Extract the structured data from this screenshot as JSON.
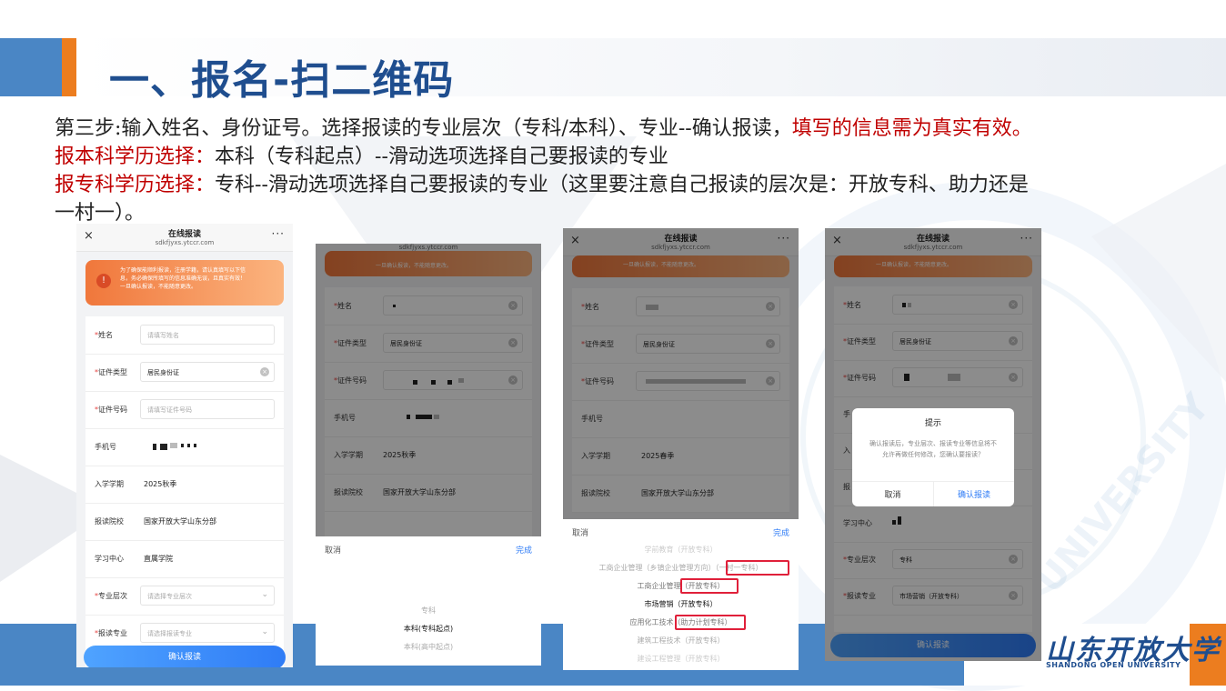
{
  "slide": {
    "title": "一、报名-扫二维码",
    "line1_black": "第三步:输入姓名、身份证号。选择报读的专业层次（专科/本科）、专业--确认报读，",
    "line1_red": "填写的信息需为真实有效。",
    "line2_red": "报本科学历选择：",
    "line2_black": "本科（专科起点）--滑动选项选择自己要报读的专业",
    "line3_red": "报专科学历选择：",
    "line3_black": "专科--滑动选项选择自己要报读的专业（这里要注意自己报读的层次是：开放专科、助力还是",
    "line4_black": "一村一）。",
    "logo_text": "山东开放大学",
    "logo_sub": "SHANDONG OPEN UNIVERSITY",
    "watermark_text": "UNIVERSITY"
  },
  "colors": {
    "title_blue": "#1f4e8f",
    "accent_orange": "#ec7d1f",
    "band_blue": "#4a86c5",
    "highlight_red": "#c00000",
    "primary_button": "#2f7cf6"
  },
  "phone_common": {
    "header_title": "在线报读",
    "header_url": "sdkfjyxs.ytccr.com",
    "close_icon": "×",
    "more_icon": "···"
  },
  "phone1": {
    "banner_lines": [
      "为了确保能顺利报读，注册学籍，请认真填写以下信",
      "息，务必确保所填写的信息准确无误，且真实有效！",
      "一旦确认报读，不能随意更改。"
    ],
    "banner_icon": "!",
    "fields": [
      {
        "label": "姓名",
        "required": true,
        "placeholder": "请填写姓名"
      },
      {
        "label": "证件类型",
        "required": true,
        "value": "居民身份证"
      },
      {
        "label": "证件号码",
        "required": true,
        "placeholder": "请填写证件号码"
      },
      {
        "label": "手机号",
        "required": false
      },
      {
        "label": "入学学期",
        "required": false,
        "value": "2025秋季"
      },
      {
        "label": "报读院校",
        "required": false,
        "value": "国家开放大学山东分部"
      },
      {
        "label": "学习中心",
        "required": false,
        "value": "直属学院"
      },
      {
        "label": "专业层次",
        "required": true,
        "placeholder": "请选择专业层次"
      },
      {
        "label": "报读专业",
        "required": true,
        "placeholder": "请选择报读专业"
      }
    ],
    "submit": "确认报读"
  },
  "phone2": {
    "url_partial": "sdkfjyxs.ytccr.com",
    "banner_partial": "一旦确认报读，不能随意更改。",
    "fields": [
      {
        "label": "姓名",
        "required": true
      },
      {
        "label": "证件类型",
        "required": true,
        "value": "居民身份证"
      },
      {
        "label": "证件号码",
        "required": true
      },
      {
        "label": "手机号",
        "required": false
      },
      {
        "label": "入学学期",
        "required": false,
        "value": "2025秋季"
      },
      {
        "label": "报读院校",
        "required": false,
        "value": "国家开放大学山东分部"
      }
    ],
    "sheet_cancel": "取消",
    "sheet_ok": "完成",
    "options": [
      "专科",
      "本科(专科起点)",
      "本科(高中起点)"
    ],
    "selected_index": 1
  },
  "phone3": {
    "banner_partial": "一旦确认报读，不能随意更改。",
    "fields": [
      {
        "label": "姓名",
        "required": true
      },
      {
        "label": "证件类型",
        "required": true,
        "value": "居民身份证"
      },
      {
        "label": "证件号码",
        "required": true
      },
      {
        "label": "手机号",
        "required": false
      },
      {
        "label": "入学学期",
        "required": false,
        "value": "2025春季"
      },
      {
        "label": "报读院校",
        "required": false,
        "value": "国家开放大学山东分部"
      }
    ],
    "sheet_cancel": "取消",
    "sheet_ok": "完成",
    "options": [
      {
        "name": "学前教育",
        "tag": "（开放专科）"
      },
      {
        "name": "工商企业管理（乡镇企业管理方向）",
        "tag": "（一村一专科）"
      },
      {
        "name": "工商企业管理",
        "tag": "（开放专科）"
      },
      {
        "name": "市场营销",
        "tag": "（开放专科）"
      },
      {
        "name": "应用化工技术",
        "tag": "（助力计划专科）"
      },
      {
        "name": "建筑工程技术",
        "tag": "（开放专科）"
      },
      {
        "name": "建设工程管理",
        "tag": "（开放专科）"
      }
    ],
    "selected_index": 3
  },
  "phone4": {
    "banner_partial": "一旦确认报读，不能随意更改。",
    "fields": [
      {
        "label": "姓名",
        "required": true
      },
      {
        "label": "证件类型",
        "required": true,
        "value": "居民身份证"
      },
      {
        "label": "证件号码",
        "required": true
      },
      {
        "label": "手",
        "required": false
      },
      {
        "label": "入",
        "required": false
      },
      {
        "label": "报",
        "required": false
      },
      {
        "label": "学习中心",
        "required": false
      },
      {
        "label": "专业层次",
        "required": true,
        "value": "专科"
      },
      {
        "label": "报读专业",
        "required": true,
        "value": "市场营销（开放专科）"
      }
    ],
    "dialog_title": "提示",
    "dialog_message": "确认报读后，专业层次、报读专业等信息将不允许再做任何修改，您确认要报读？",
    "dialog_cancel": "取消",
    "dialog_confirm": "确认报读",
    "submit": "确认报读"
  }
}
